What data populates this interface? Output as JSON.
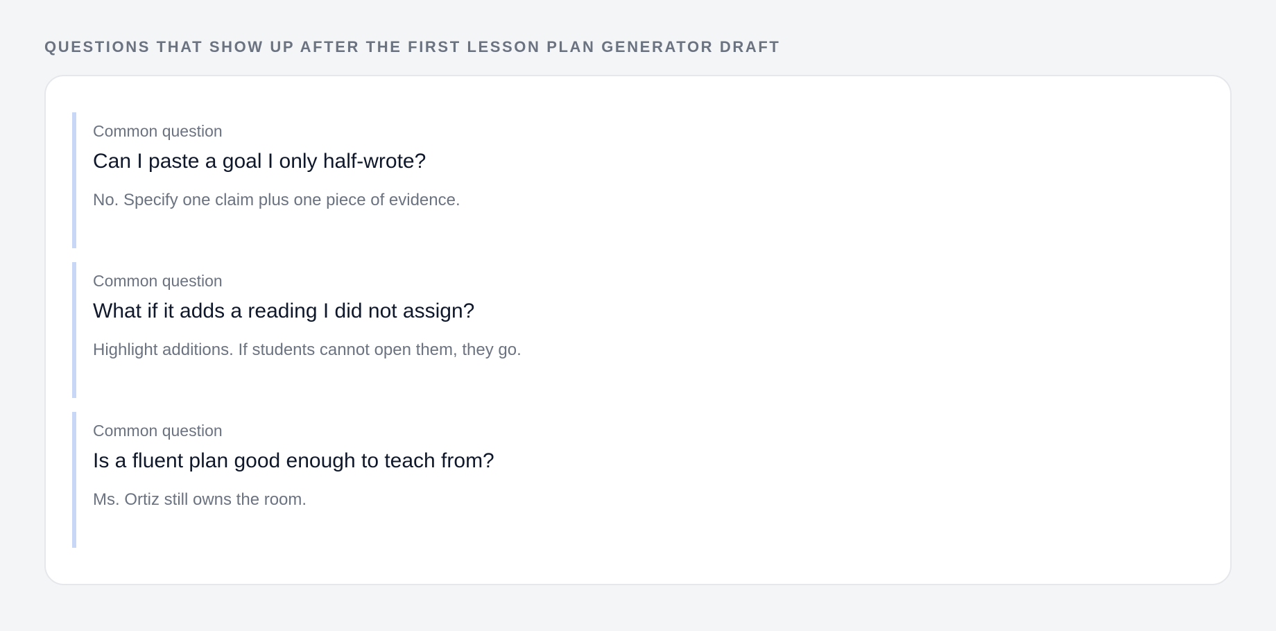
{
  "section": {
    "heading": "QUESTIONS THAT SHOW UP AFTER THE FIRST LESSON PLAN GENERATOR DRAFT"
  },
  "faq": {
    "items": [
      {
        "kicker": "Common question",
        "question": "Can I paste a goal I only half-wrote?",
        "answer": "No. Specify one claim plus one piece of evidence."
      },
      {
        "kicker": "Common question",
        "question": "What if it adds a reading I did not assign?",
        "answer": "Highlight additions. If students cannot open them, they go."
      },
      {
        "kicker": "Common question",
        "question": "Is a fluent plan good enough to teach from?",
        "answer": "Ms. Ortiz still owns the room."
      }
    ]
  },
  "colors": {
    "page_background": "#f4f5f7",
    "card_background": "#ffffff",
    "accent_bar": "#c7d7f5",
    "muted_text": "#6b7280",
    "primary_text": "#0f172a"
  }
}
